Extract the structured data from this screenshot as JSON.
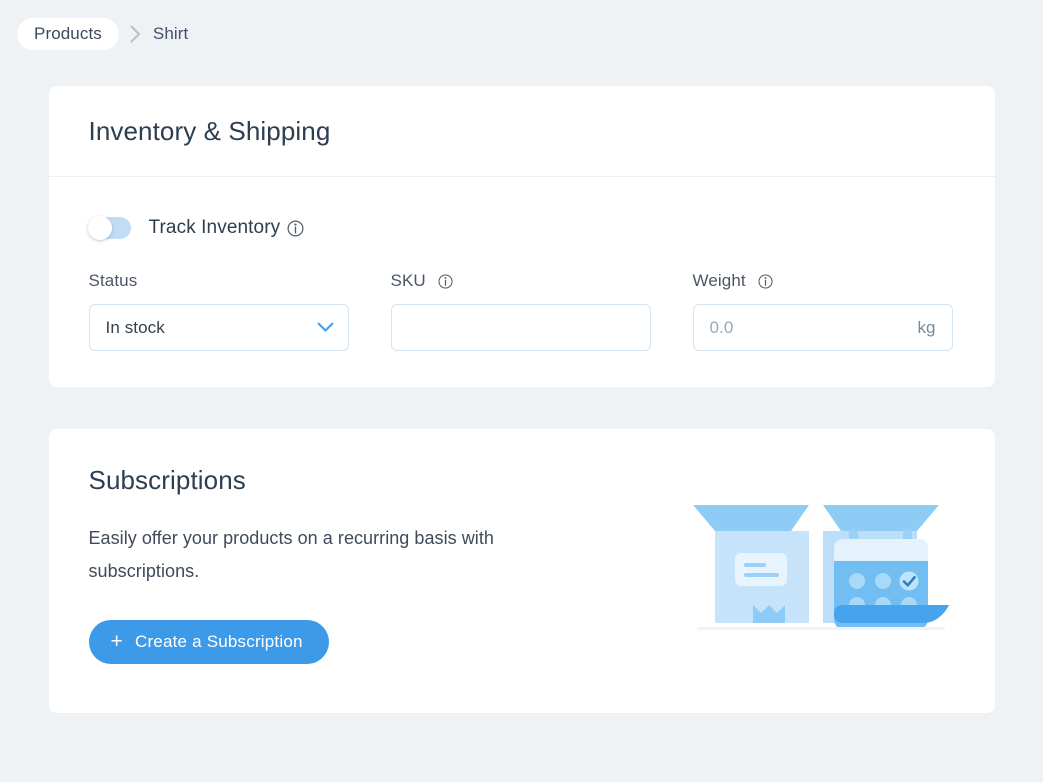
{
  "breadcrumb": {
    "parent_label": "Products",
    "separator_icon": "chevron-right-icon",
    "current_label": "Shirt"
  },
  "inventory_card": {
    "title": "Inventory & Shipping",
    "track_inventory": {
      "label": "Track Inventory",
      "enabled": false,
      "info_icon": "info-icon"
    },
    "fields": {
      "status": {
        "label": "Status",
        "value": "In stock",
        "options": [
          "In stock"
        ],
        "chevron_icon": "chevron-down-icon"
      },
      "sku": {
        "label": "SKU",
        "value": "",
        "placeholder": "",
        "info_icon": "info-icon"
      },
      "weight": {
        "label": "Weight",
        "value": "",
        "placeholder": "0.0",
        "unit": "kg",
        "info_icon": "info-icon"
      }
    }
  },
  "subscriptions_card": {
    "title": "Subscriptions",
    "description": "Easily offer your products on a recurring basis with subscriptions.",
    "cta_label": "Create a Subscription",
    "cta_plus_icon": "plus-icon",
    "illustration_name": "open-box-with-calendar-illustration"
  },
  "colors": {
    "page_background": "#eff2f5",
    "card_background": "#ffffff",
    "accent_blue": "#3d9ae8",
    "toggle_track_off": "#c3dcf5",
    "field_border": "#d4e4f1",
    "heading_text": "#2d3e50",
    "illustration_light": "#c7e3f9",
    "illustration_mid": "#8ecbf5",
    "illustration_dark": "#4aa8ef"
  }
}
